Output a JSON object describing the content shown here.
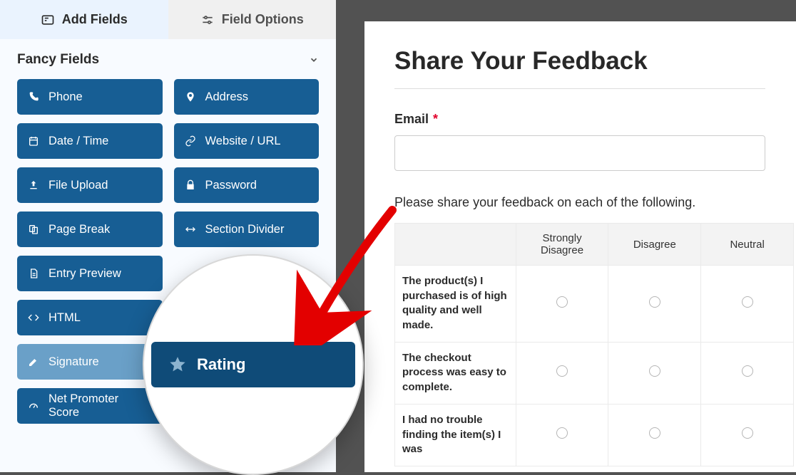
{
  "tabs": {
    "add_fields": "Add Fields",
    "field_options": "Field Options"
  },
  "section_title": "Fancy Fields",
  "fields": {
    "phone": "Phone",
    "address": "Address",
    "datetime": "Date / Time",
    "website": "Website / URL",
    "upload": "File Upload",
    "password": "Password",
    "pagebreak": "Page Break",
    "section": "Section Divider",
    "entry": "Entry Preview",
    "html": "HTML",
    "rating": "Rating",
    "signature": "Signature",
    "nps": "Net Promoter Score"
  },
  "form": {
    "title": "Share Your Feedback",
    "email_label": "Email",
    "matrix_prompt": "Please share your feedback on each of the following.",
    "columns": [
      "Strongly Disagree",
      "Disagree",
      "Neutral"
    ],
    "rows": [
      "The product(s) I purchased is of high quality and well made.",
      "The checkout process was easy to complete.",
      "I had no trouble finding the item(s) I was"
    ]
  }
}
